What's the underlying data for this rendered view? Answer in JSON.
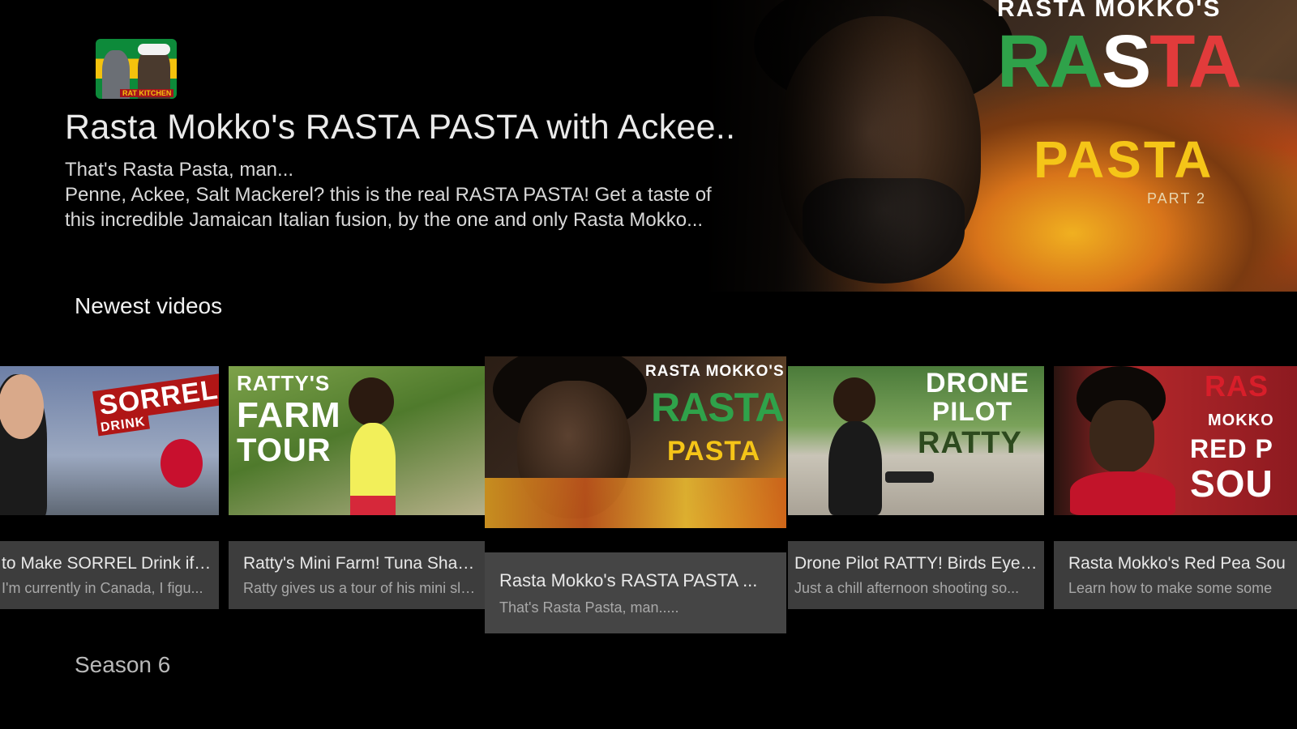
{
  "hero": {
    "channel_avatar_text": "RAT KITCHEN",
    "title": "Rasta Mokko's RASTA PASTA with Ackee..",
    "description_line1": "That's Rasta Pasta, man...",
    "description_line2": "Penne, Ackee, Salt Mackerel? this is the real RASTA PASTA! Get a taste of",
    "description_line3": "this incredible Jamaican Italian fusion, by the one and only Rasta Mokko...",
    "art": {
      "top_text": "RASTA MOKKO'S",
      "rasta_letters": [
        "R",
        "A",
        "S",
        "T",
        "A"
      ],
      "pasta_text": "PASTA",
      "part_text": "PART 2"
    }
  },
  "section": {
    "title": "Newest videos"
  },
  "videos": [
    {
      "title": "to Make SORREL Drink if ...",
      "subtitle": "I'm currently in Canada, I figu...",
      "thumb_text_1": "SORREL",
      "thumb_text_2": "DRINK"
    },
    {
      "title": "Ratty's Mini Farm! Tuna Shamp...",
      "subtitle": "Ratty gives us a tour of his mini slo...",
      "thumb_text_1": "RATTY'S",
      "thumb_text_2": "FARM",
      "thumb_text_3": "TOUR"
    },
    {
      "title": "Rasta Mokko's RASTA PASTA ...",
      "subtitle": "That's Rasta Pasta, man.....",
      "thumb_text_1": "RASTA MOKKO'S",
      "thumb_text_2": "RASTA",
      "thumb_text_3": "PASTA"
    },
    {
      "title": "Drone Pilot RATTY! Birds Eye V...",
      "subtitle": "Just a chill afternoon shooting so...",
      "thumb_text_1": "DRONE",
      "thumb_text_2": "PILOT",
      "thumb_text_3": "RATTY"
    },
    {
      "title": "Rasta Mokko's Red Pea Sou",
      "subtitle": "Learn how to make some some",
      "thumb_text_1": "RAS",
      "thumb_text_2": "MOKKO",
      "thumb_text_3": "RED P",
      "thumb_text_4": "SOU"
    }
  ],
  "next_section": {
    "title": "Season 6"
  },
  "colors": {
    "background": "#000000",
    "card_meta": "#3d3d3d",
    "card_meta_focused": "#454545",
    "rasta_green": "#2fa24a",
    "rasta_red": "#e23b3b",
    "pasta_yellow": "#f5c518"
  }
}
